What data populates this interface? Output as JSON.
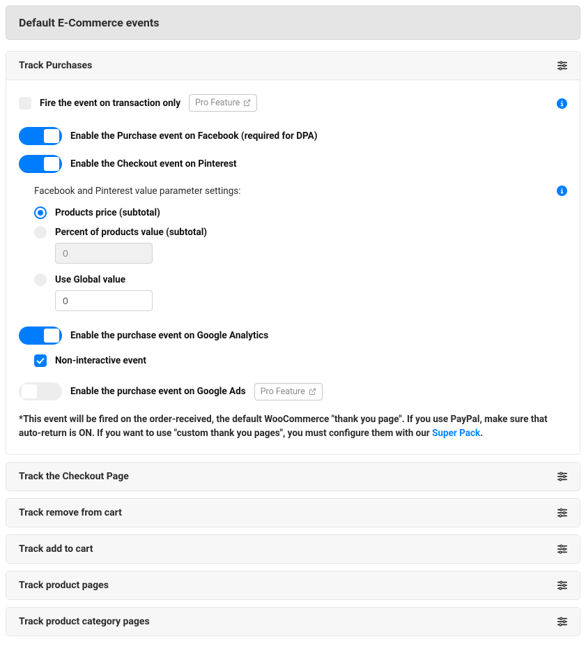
{
  "page_title": "Default E-Commerce events",
  "sections": {
    "purchases": {
      "title": "Track Purchases"
    },
    "checkout": {
      "title": "Track the Checkout Page"
    },
    "remove_cart": {
      "title": "Track remove from cart"
    },
    "add_cart": {
      "title": "Track add to cart"
    },
    "product_pages": {
      "title": "Track product pages"
    },
    "category_pages": {
      "title": "Track product category pages"
    }
  },
  "purchases": {
    "fire_on_transaction": "Fire the event on transaction only",
    "pro_feature": "Pro Feature",
    "fb_purchase": "Enable the Purchase event on Facebook (required for DPA)",
    "pinterest_checkout": "Enable the Checkout event on Pinterest",
    "value_heading": "Facebook and Pinterest value parameter settings:",
    "opt_products_price": "Products price (subtotal)",
    "opt_percent": "Percent of products value (subtotal)",
    "percent_value": "0",
    "opt_global": "Use Global value",
    "global_value": "0",
    "ga_purchase": "Enable the purchase event on Google Analytics",
    "non_interactive": "Non-interactive event",
    "gads_purchase": "Enable the purchase event on Google Ads",
    "note_prefix": "*This event will be fired on the order-received, the default WooCommerce \"thank you page\". If you use PayPal, make sure that auto-return is ON. If you want to use \"custom thank you pages\", you must configure them with our ",
    "note_link": "Super Pack",
    "note_period": "."
  }
}
